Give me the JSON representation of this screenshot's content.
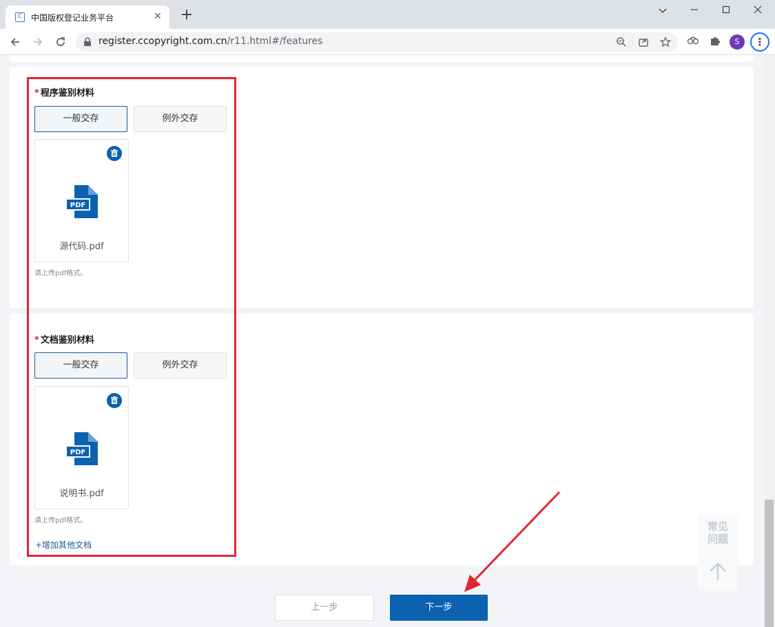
{
  "browser": {
    "tab_title": "中国版权登记业务平台",
    "tab_favicon_letter": "C",
    "url_host": "register.ccopyright.com.cn",
    "url_path": "/r11.html#/features",
    "profile_initial": "S"
  },
  "sections": [
    {
      "required_mark": "*",
      "title": "程序鉴别材料",
      "options": [
        "一般交存",
        "例外交存"
      ],
      "selected_option": "一般交存",
      "file_name": "源代码.pdf",
      "file_badge": "PDF",
      "hint": "请上传pdf格式。"
    },
    {
      "required_mark": "*",
      "title": "文档鉴别材料",
      "options": [
        "一般交存",
        "例外交存"
      ],
      "selected_option": "一般交存",
      "file_name": "说明书.pdf",
      "file_badge": "PDF",
      "hint": "请上传pdf格式。",
      "add_link": "+增加其他文档"
    }
  ],
  "faq": {
    "line1": "常见",
    "line2": "问题"
  },
  "footer": {
    "prev_label": "上一步",
    "next_label": "下一步"
  },
  "colors": {
    "primary": "#0a62b0",
    "annotation": "#e02631",
    "required": "#e02020"
  }
}
